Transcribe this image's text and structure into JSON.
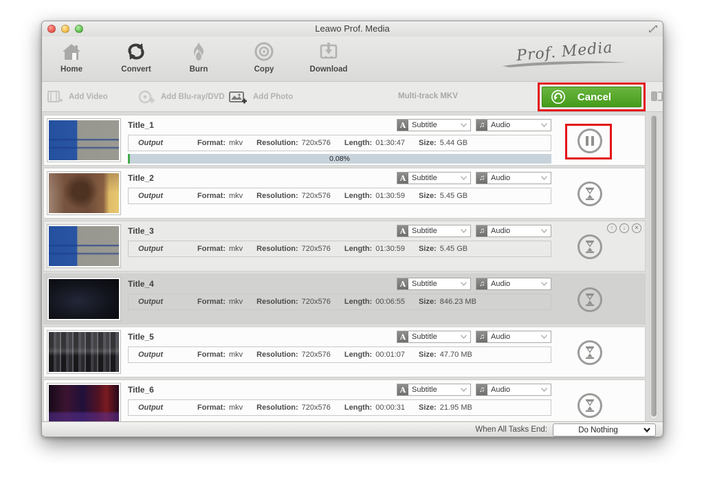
{
  "window": {
    "title": "Leawo Prof. Media"
  },
  "brand": {
    "logo_text": "Prof. Media"
  },
  "toolbar": {
    "items": [
      {
        "label": "Home",
        "icon": "home-icon",
        "active": false
      },
      {
        "label": "Convert",
        "icon": "convert-icon",
        "active": true
      },
      {
        "label": "Burn",
        "icon": "burn-icon",
        "active": false
      },
      {
        "label": "Copy",
        "icon": "copy-icon",
        "active": false
      },
      {
        "label": "Download",
        "icon": "download-icon",
        "active": false
      }
    ]
  },
  "subtoolbar": {
    "add_video": "Add Video",
    "add_bluray": "Add Blu-ray/DVD",
    "add_photo": "Add Photo",
    "multitrack": "Multi-track MKV",
    "cancel": "Cancel"
  },
  "labels": {
    "output": "Output",
    "format": "Format:",
    "resolution": "Resolution:",
    "length": "Length:",
    "size": "Size:"
  },
  "combos": {
    "subtitle": "Subtitle",
    "audio": "Audio"
  },
  "rows": [
    {
      "title": "Title_1",
      "format": "mkv",
      "resolution": "720x576",
      "length": "01:30:47",
      "size": "5.44 GB",
      "progress": "0.08%",
      "button": "pause",
      "annotated": true,
      "controls": false,
      "thumb": "blue-gray",
      "bg": "white"
    },
    {
      "title": "Title_2",
      "format": "mkv",
      "resolution": "720x576",
      "length": "01:30:59",
      "size": "5.45 GB",
      "progress": "",
      "button": "wait",
      "annotated": false,
      "controls": false,
      "thumb": "tan",
      "bg": "white"
    },
    {
      "title": "Title_3",
      "format": "mkv",
      "resolution": "720x576",
      "length": "01:30:59",
      "size": "5.45 GB",
      "progress": "",
      "button": "wait",
      "annotated": false,
      "controls": true,
      "thumb": "blue-gray",
      "bg": "hover"
    },
    {
      "title": "Title_4",
      "format": "mkv",
      "resolution": "720x576",
      "length": "00:06:55",
      "size": "846.23 MB",
      "progress": "",
      "button": "wait",
      "annotated": false,
      "controls": false,
      "thumb": "dark",
      "bg": "selected"
    },
    {
      "title": "Title_5",
      "format": "mkv",
      "resolution": "720x576",
      "length": "00:01:07",
      "size": "47.70 MB",
      "progress": "",
      "button": "wait",
      "annotated": false,
      "controls": false,
      "thumb": "stripes",
      "bg": "white"
    },
    {
      "title": "Title_6",
      "format": "mkv",
      "resolution": "720x576",
      "length": "00:00:31",
      "size": "21.95 MB",
      "progress": "",
      "button": "wait",
      "annotated": false,
      "controls": false,
      "thumb": "purple",
      "bg": "white"
    }
  ],
  "footer": {
    "label": "When All Tasks End:",
    "value": "Do Nothing"
  },
  "colors": {
    "accent_green": "#459c1b",
    "annotation_red": "#e41317",
    "progress_bg": "#c7d2db",
    "progress_fill": "#3faa49"
  }
}
